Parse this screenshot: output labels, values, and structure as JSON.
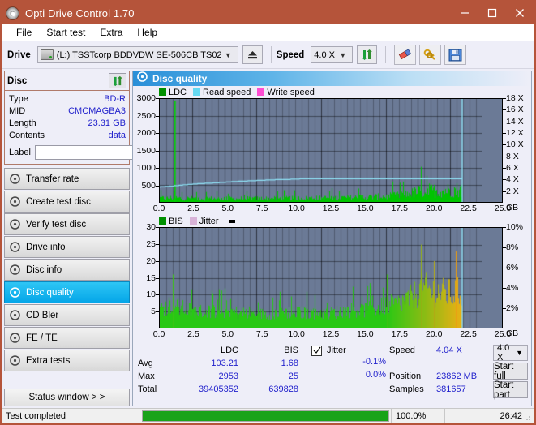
{
  "window": {
    "title": "Opti Drive Control 1.70",
    "app_icon": "disc-icon",
    "minimize": "─",
    "maximize": "☐",
    "close": "✕"
  },
  "menubar": {
    "items": [
      "File",
      "Start test",
      "Extra",
      "Help"
    ]
  },
  "toolbar": {
    "drive_label": "Drive",
    "drive_value": "(L:)  TSSTcorp BDDVDW SE-506CB TS02",
    "eject_icon": "eject-icon",
    "speed_label": "Speed",
    "speed_value": "4.0 X",
    "refresh_icon": "refresh-icon",
    "erase_icon": "eraser-icon",
    "keys_icon": "keys-icon",
    "save_icon": "floppy-save-icon"
  },
  "sidebar": {
    "disc_panel": {
      "title": "Disc",
      "refresh_icon": "refresh-icon",
      "rows": [
        {
          "key": "Type",
          "value": "BD-R"
        },
        {
          "key": "MID",
          "value": "CMCMAGBA3"
        },
        {
          "key": "Length",
          "value": "23.31 GB"
        },
        {
          "key": "Contents",
          "value": "data"
        }
      ],
      "label_key": "Label",
      "label_value": "",
      "label_placeholder": "",
      "cd_icon": "cd-icon"
    },
    "nav_items": [
      {
        "label": "Transfer rate",
        "active": false
      },
      {
        "label": "Create test disc",
        "active": false
      },
      {
        "label": "Verify test disc",
        "active": false
      },
      {
        "label": "Drive info",
        "active": false
      },
      {
        "label": "Disc info",
        "active": false
      },
      {
        "label": "Disc quality",
        "active": true
      },
      {
        "label": "CD Bler",
        "active": false
      },
      {
        "label": "FE / TE",
        "active": false
      },
      {
        "label": "Extra tests",
        "active": false
      }
    ],
    "status_window_button": "Status window > >"
  },
  "main": {
    "header_title": "Disc quality",
    "header_icon": "disc-quality-icon"
  },
  "stats": {
    "col_headers": [
      "LDC",
      "BIS"
    ],
    "rows": [
      {
        "name": "Avg",
        "ldc": "103.21",
        "bis": "1.68",
        "jitter": "-0.1%"
      },
      {
        "name": "Max",
        "ldc": "2953",
        "bis": "25",
        "jitter": "0.0%"
      },
      {
        "name": "Total",
        "ldc": "39405352",
        "bis": "639828",
        "jitter": ""
      }
    ],
    "jitter_label": "Jitter",
    "jitter_checked": true,
    "speed_label": "Speed",
    "speed_value": "4.04 X",
    "position_label": "Position",
    "position_value": "23862 MB",
    "samples_label": "Samples",
    "samples_value": "381657",
    "speed_select": "4.0 X",
    "start_full_button": "Start full",
    "start_part_button": "Start part"
  },
  "statusbar": {
    "text": "Test completed",
    "percent_label": "100.0%",
    "percent_value": 100,
    "time": "26:42"
  },
  "colors": {
    "titlebar": "#b5543a",
    "accent_blue": "#05a6e8",
    "value_text": "#2222cc",
    "ldc_green": "#00c000",
    "read_speed": "#66d9f2",
    "write_speed": "#ff4dd2",
    "bis_green": "#22c000",
    "jitter_pink": "#d8b3d8",
    "plot_bg": "#6b7a96",
    "progress_green": "#19a319"
  },
  "chart_data": [
    {
      "type": "area",
      "title": "LDC / Read speed",
      "legend": [
        {
          "name": "LDC",
          "color": "#009000"
        },
        {
          "name": "Read speed",
          "color": "#66d9f2"
        },
        {
          "name": "Write speed",
          "color": "#ff4dd2"
        }
      ],
      "legend_position": "top-left",
      "grid": true,
      "xlabel": "GB",
      "x": [
        0.0,
        2.5,
        5.0,
        7.5,
        10.0,
        12.5,
        15.0,
        17.5,
        20.0,
        22.5,
        25.0
      ],
      "xlim": [
        0,
        25
      ],
      "ylabel_left": "LDC",
      "ylim_left": [
        0,
        3000
      ],
      "yticks_left": [
        500,
        1000,
        1500,
        2000,
        2500,
        3000
      ],
      "ylabel_right": "Speed",
      "ylim_right": [
        0,
        18
      ],
      "yticks_right": [
        "2 X",
        "4 X",
        "6 X",
        "8 X",
        "10 X",
        "12 X",
        "14 X",
        "16 X",
        "18 X"
      ],
      "series": [
        {
          "name": "LDC",
          "color": "#00c000",
          "type": "area",
          "description": "dense spiky error counts, baseline ~100-250, rising to ~500-900 after 19 GB, single spike to 2953 near 1.1 GB, data ends at 23.4 GB",
          "baseline": 120,
          "spike_x": 1.1,
          "spike_y": 2953,
          "profile": [
            [
              0.0,
              170
            ],
            [
              0.5,
              150
            ],
            [
              1.0,
              180
            ],
            [
              1.5,
              160
            ],
            [
              2.0,
              150
            ],
            [
              2.5,
              155
            ],
            [
              3.0,
              150
            ],
            [
              3.5,
              145
            ],
            [
              4.0,
              150
            ],
            [
              4.5,
              145
            ],
            [
              5.0,
              150
            ],
            [
              5.5,
              145
            ],
            [
              6.0,
              150
            ],
            [
              6.5,
              145
            ],
            [
              7.0,
              145
            ],
            [
              7.5,
              150
            ],
            [
              8.0,
              150
            ],
            [
              8.5,
              145
            ],
            [
              9.0,
              150
            ],
            [
              9.5,
              155
            ],
            [
              10.0,
              155
            ],
            [
              10.5,
              155
            ],
            [
              11.0,
              160
            ],
            [
              11.5,
              160
            ],
            [
              12.0,
              165
            ],
            [
              12.5,
              165
            ],
            [
              13.0,
              170
            ],
            [
              13.5,
              170
            ],
            [
              14.0,
              180
            ],
            [
              14.5,
              180
            ],
            [
              15.0,
              190
            ],
            [
              15.5,
              200
            ],
            [
              16.0,
              200
            ],
            [
              16.5,
              210
            ],
            [
              17.0,
              220
            ],
            [
              17.5,
              230
            ],
            [
              18.0,
              250
            ],
            [
              18.5,
              270
            ],
            [
              19.0,
              300
            ],
            [
              19.5,
              360
            ],
            [
              20.0,
              430
            ],
            [
              20.5,
              470
            ],
            [
              21.0,
              480
            ],
            [
              21.5,
              470
            ],
            [
              22.0,
              480
            ],
            [
              22.5,
              500
            ],
            [
              23.0,
              510
            ],
            [
              23.4,
              500
            ]
          ]
        },
        {
          "name": "Read speed",
          "color": "#66d9f2",
          "type": "line",
          "description": "stepped CAV read speed rising from ~2.6X at 0 GB to ~4.05X flat after 11 GB, vertical drop line at 23.4 GB",
          "profile": [
            [
              0.0,
              2.6
            ],
            [
              1.0,
              2.8
            ],
            [
              2.0,
              3.0
            ],
            [
              3.0,
              3.2
            ],
            [
              4.0,
              3.3
            ],
            [
              5.0,
              3.45
            ],
            [
              6.0,
              3.6
            ],
            [
              7.0,
              3.7
            ],
            [
              8.0,
              3.8
            ],
            [
              9.0,
              3.9
            ],
            [
              10.0,
              3.95
            ],
            [
              11.0,
              4.05
            ],
            [
              15.0,
              4.05
            ],
            [
              20.0,
              4.05
            ],
            [
              23.4,
              4.05
            ]
          ]
        },
        {
          "name": "Write speed",
          "color": "#ff4dd2",
          "type": "line",
          "description": "not plotted (no write pass)",
          "profile": []
        }
      ]
    },
    {
      "type": "area",
      "title": "BIS / Jitter",
      "legend": [
        {
          "name": "BIS",
          "color": "#009000"
        },
        {
          "name": "Jitter",
          "color": "#d8b3d8"
        }
      ],
      "legend_position": "top-left",
      "grid": true,
      "xlabel": "GB",
      "x": [
        0.0,
        2.5,
        5.0,
        7.5,
        10.0,
        12.5,
        15.0,
        17.5,
        20.0,
        22.5,
        25.0
      ],
      "xlim": [
        0,
        25
      ],
      "ylabel_left": "BIS",
      "ylim_left": [
        0,
        30
      ],
      "yticks_left": [
        5,
        10,
        15,
        20,
        25,
        30
      ],
      "ylabel_right": "Jitter",
      "ylim_right": [
        0,
        10
      ],
      "yticks_right": [
        "2%",
        "4%",
        "6%",
        "8%",
        "10%"
      ],
      "series": [
        {
          "name": "BIS",
          "color": "#22c000",
          "type": "area",
          "description": "dense spiky counts, baseline ~5-7 up to 17 GB, rising to ~10-17 after 19.5 GB with peaks to 25 near 20.2 GB and 23 near 22.9 GB, ends at 23.4 GB",
          "profile": [
            [
              0.0,
              7
            ],
            [
              0.5,
              8
            ],
            [
              1.0,
              9
            ],
            [
              1.5,
              7
            ],
            [
              2.0,
              7
            ],
            [
              2.5,
              6
            ],
            [
              3.0,
              6
            ],
            [
              3.5,
              6
            ],
            [
              4.0,
              6
            ],
            [
              4.5,
              6
            ],
            [
              5.0,
              6
            ],
            [
              5.5,
              6
            ],
            [
              6.0,
              5.5
            ],
            [
              6.5,
              5.5
            ],
            [
              7.0,
              5.5
            ],
            [
              7.5,
              5
            ],
            [
              8.0,
              5
            ],
            [
              8.5,
              5
            ],
            [
              9.0,
              5
            ],
            [
              9.5,
              6
            ],
            [
              10.0,
              5.5
            ],
            [
              10.5,
              5.5
            ],
            [
              11.0,
              5.5
            ],
            [
              11.5,
              5.5
            ],
            [
              12.0,
              5.5
            ],
            [
              12.5,
              5.5
            ],
            [
              13.0,
              5
            ],
            [
              13.5,
              5.5
            ],
            [
              14.0,
              6
            ],
            [
              14.5,
              6
            ],
            [
              15.0,
              6.5
            ],
            [
              15.5,
              6.5
            ],
            [
              16.0,
              6.5
            ],
            [
              16.5,
              7
            ],
            [
              17.0,
              7.5
            ],
            [
              17.5,
              8
            ],
            [
              18.0,
              8.5
            ],
            [
              18.5,
              9
            ],
            [
              19.0,
              10
            ],
            [
              19.5,
              11
            ],
            [
              20.0,
              13
            ],
            [
              20.3,
              14
            ],
            [
              20.6,
              14
            ],
            [
              21.0,
              13.5
            ],
            [
              21.5,
              13
            ],
            [
              22.0,
              12.5
            ],
            [
              22.5,
              12.5
            ],
            [
              23.0,
              13
            ],
            [
              23.4,
              12
            ]
          ],
          "peaks": [
            [
              20.2,
              25
            ],
            [
              22.9,
              23
            ],
            [
              21.2,
              20
            ],
            [
              1.0,
              16
            ],
            [
              17.6,
              16
            ]
          ]
        },
        {
          "name": "Jitter",
          "color": "#d8b3d8",
          "type": "line",
          "description": "not plotted / flat near zero",
          "profile": []
        }
      ]
    }
  ]
}
